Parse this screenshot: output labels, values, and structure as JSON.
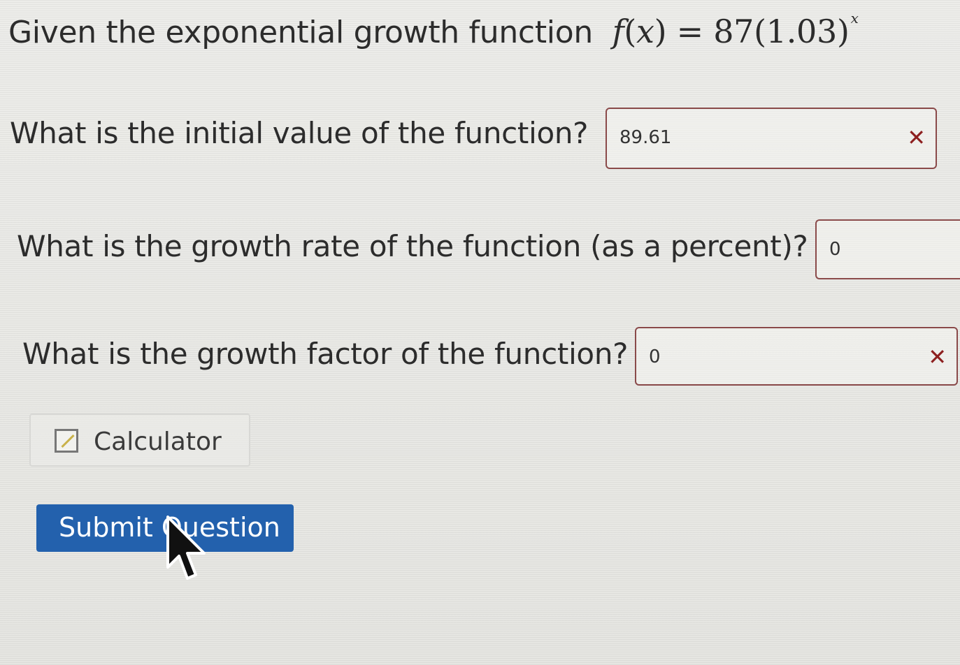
{
  "prompt": {
    "text": "Given the exponential growth function",
    "math_func": "f",
    "math_open": "(",
    "math_var": "x",
    "math_close": ")",
    "math_eq": " = ",
    "math_coef": "87",
    "math_base": "(1.03)",
    "math_exp": "x"
  },
  "questions": [
    {
      "label": "What is the initial value of the function?",
      "answer": "89.61",
      "feedback": "✕"
    },
    {
      "label": "What is the growth rate of the function (as a percent)?",
      "answer": "0"
    },
    {
      "label": "What is the growth factor of the function?",
      "answer": "0",
      "feedback": "✕"
    }
  ],
  "calculator": {
    "label": "Calculator",
    "icon": "calculator-icon"
  },
  "submit": {
    "label": "Submit Question"
  },
  "cursor": {
    "icon": "mouse-pointer-icon"
  },
  "colors": {
    "submit_bg": "#2361ad",
    "error_border": "#8a4a4a",
    "error_mark": "#8d1f1f"
  }
}
